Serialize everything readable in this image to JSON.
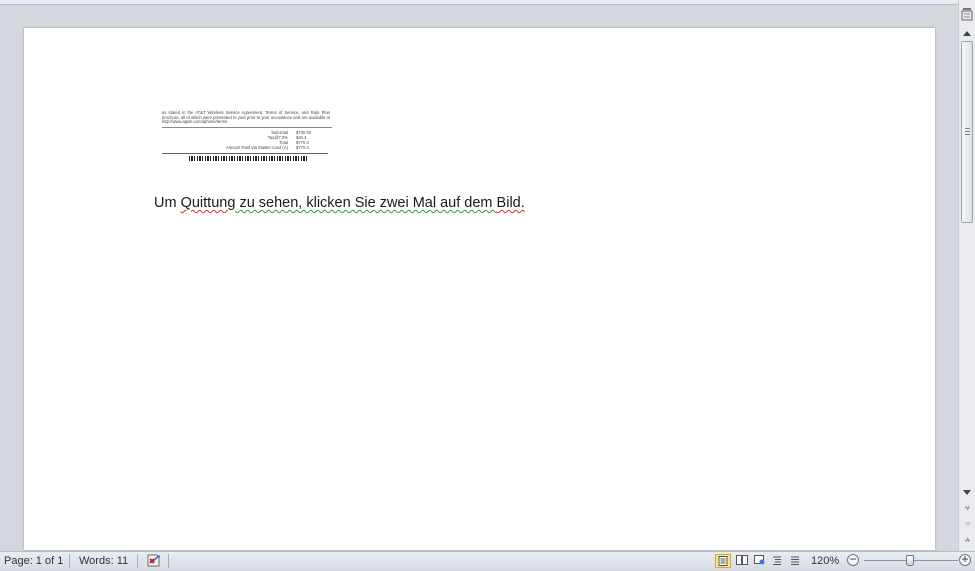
{
  "document": {
    "body_text": {
      "part1": "Um ",
      "part2": "Quittung",
      "part3": " zu sehen, klicken Sie zwei Mal auf dem ",
      "part4": "Bild."
    },
    "receipt_image": {
      "terms_text": "as stated in the AT&T Wireless Service Agreement, Terms of Service, and Rate Plan brochure, all of which were presented to your prior to your acceptance and are available at http://www.apple.com/iphone/terms",
      "rows": [
        {
          "label": "Sub-total",
          "value": "$730.00"
        },
        {
          "label": "Tax@7.0%",
          "value": "$40.4"
        },
        {
          "label": "Total",
          "value": "$770.4"
        },
        {
          "label": "Amount Paid Via Master Card (A)",
          "value": "$770.4"
        }
      ]
    }
  },
  "status_bar": {
    "page": "Page: 1 of 1",
    "words": "Words: 11",
    "zoom_level": "120%",
    "zoom_minus": "−",
    "zoom_plus": "+"
  },
  "scrollbar": {
    "prev_glyph": "⩝",
    "browse_glyph": "○",
    "next_glyph": "⩜"
  },
  "icons": {
    "proofing": "proofing-errors-icon",
    "print_layout": "print-layout-icon",
    "full_screen_reading": "full-screen-reading-icon",
    "web_layout": "web-layout-icon",
    "outline": "outline-icon",
    "draft": "draft-icon",
    "view_ruler": "view-ruler-icon"
  },
  "colors": {
    "spelling_error": "#e0291c",
    "grammar_error": "#2e9c3a",
    "active_view": "#ffe28a"
  }
}
